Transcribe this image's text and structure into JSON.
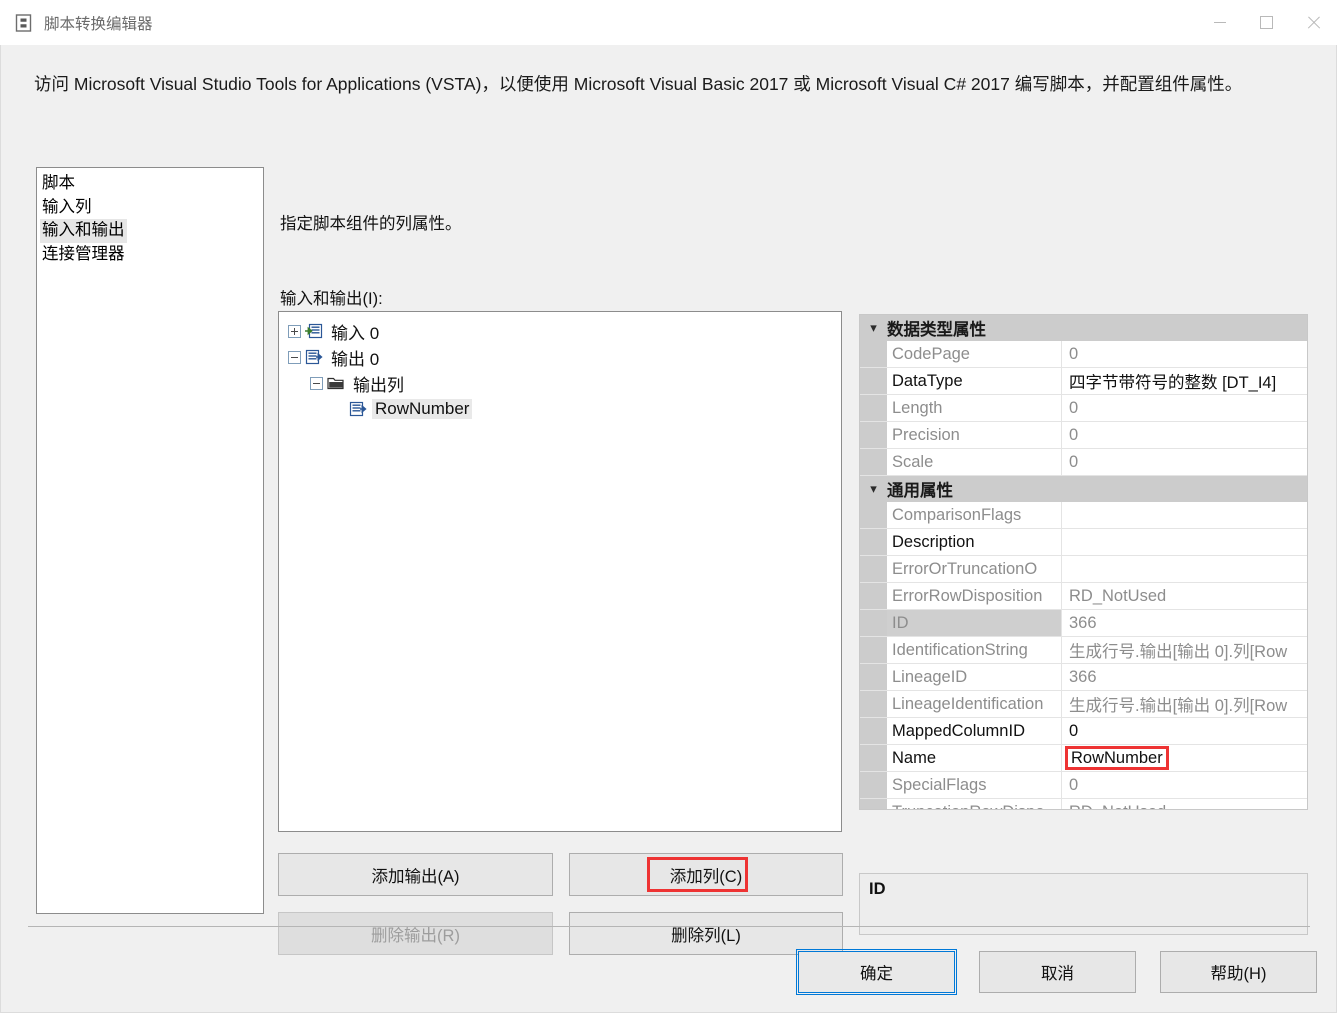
{
  "window": {
    "title": "脚本转换编辑器",
    "app_icon": "script-transform-icon",
    "minimize_label": "最小化",
    "maximize_label": "最大化",
    "close_label": "关闭"
  },
  "intro": "访问 Microsoft Visual Studio Tools for Applications (VSTA)，以便使用 Microsoft Visual Basic 2017 或 Microsoft Visual C# 2017 编写脚本，并配置组件属性。",
  "nav": {
    "items": [
      {
        "label": "脚本",
        "selected": false
      },
      {
        "label": "输入列",
        "selected": false
      },
      {
        "label": "输入和输出",
        "selected": true
      },
      {
        "label": "连接管理器",
        "selected": false
      }
    ]
  },
  "main": {
    "sub_instruction": "指定脚本组件的列属性。",
    "io_label": "输入和输出(I):",
    "tree": [
      {
        "label": "输入 0",
        "icon": "input-icon",
        "expander": "plus",
        "depth": 0,
        "selected": false
      },
      {
        "label": "输出 0",
        "icon": "output-icon",
        "expander": "minus",
        "depth": 0,
        "selected": false
      },
      {
        "label": "输出列",
        "icon": "folder-icon",
        "expander": "minus",
        "depth": 1,
        "selected": false
      },
      {
        "label": "RowNumber",
        "icon": "column-icon",
        "expander": "none",
        "depth": 2,
        "selected": true
      }
    ],
    "buttons": {
      "add_output": "添加输出(A)",
      "add_column": "添加列(C)",
      "delete_output": "删除输出(R)",
      "delete_column": "删除列(L)"
    }
  },
  "properties": {
    "sections": [
      {
        "title": "数据类型属性",
        "expanded": true,
        "rows": [
          {
            "name": "CodePage",
            "value": "0",
            "name_strong": false,
            "value_strong": false,
            "selected": false,
            "annotated": false
          },
          {
            "name": "DataType",
            "value": "四字节带符号的整数 [DT_I4]",
            "name_strong": true,
            "value_strong": true,
            "selected": false,
            "annotated": false
          },
          {
            "name": "Length",
            "value": "0",
            "name_strong": false,
            "value_strong": false,
            "selected": false,
            "annotated": false
          },
          {
            "name": "Precision",
            "value": "0",
            "name_strong": false,
            "value_strong": false,
            "selected": false,
            "annotated": false
          },
          {
            "name": "Scale",
            "value": "0",
            "name_strong": false,
            "value_strong": false,
            "selected": false,
            "annotated": false
          }
        ]
      },
      {
        "title": "通用属性",
        "expanded": true,
        "rows": [
          {
            "name": "ComparisonFlags",
            "value": "",
            "name_strong": false,
            "value_strong": false,
            "selected": false,
            "annotated": false
          },
          {
            "name": "Description",
            "value": "",
            "name_strong": true,
            "value_strong": false,
            "selected": false,
            "annotated": false
          },
          {
            "name": "ErrorOrTruncationO",
            "value": "",
            "name_strong": false,
            "value_strong": false,
            "selected": false,
            "annotated": false
          },
          {
            "name": "ErrorRowDisposition",
            "value": "RD_NotUsed",
            "name_strong": false,
            "value_strong": false,
            "selected": false,
            "annotated": false
          },
          {
            "name": "ID",
            "value": "366",
            "name_strong": false,
            "value_strong": false,
            "selected": true,
            "annotated": false
          },
          {
            "name": "IdentificationString",
            "value": "生成行号.输出[输出 0].列[Row",
            "name_strong": false,
            "value_strong": false,
            "selected": false,
            "annotated": false
          },
          {
            "name": "LineageID",
            "value": "366",
            "name_strong": false,
            "value_strong": false,
            "selected": false,
            "annotated": false
          },
          {
            "name": "LineageIdentification",
            "value": "生成行号.输出[输出 0].列[Row",
            "name_strong": false,
            "value_strong": false,
            "selected": false,
            "annotated": false
          },
          {
            "name": "MappedColumnID",
            "value": "0",
            "name_strong": true,
            "value_strong": true,
            "selected": false,
            "annotated": false
          },
          {
            "name": "Name",
            "value": "RowNumber",
            "name_strong": true,
            "value_strong": true,
            "selected": false,
            "annotated": true
          },
          {
            "name": "SpecialFlags",
            "value": "0",
            "name_strong": false,
            "value_strong": false,
            "selected": false,
            "annotated": false
          },
          {
            "name": "TruncationRowDispo",
            "value": "RD_NotUsed",
            "name_strong": false,
            "value_strong": false,
            "selected": false,
            "annotated": false
          }
        ]
      }
    ],
    "description_title": "ID"
  },
  "footer": {
    "ok": "确定",
    "cancel": "取消",
    "help": "帮助(H)"
  },
  "colors": {
    "accent": "#0078d7",
    "annotation": "#ee3333",
    "category_bg": "#cccccc",
    "dialog_bg": "#f0f0f0"
  }
}
